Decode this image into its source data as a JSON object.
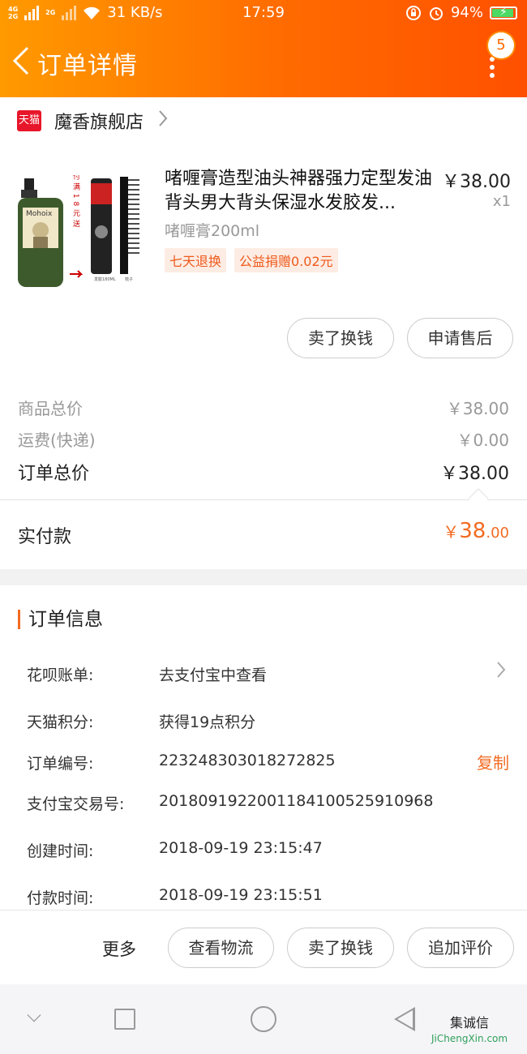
{
  "status_bar": {
    "network_top": "4G",
    "network_bottom": "2G",
    "network2": "2G",
    "speed": "31 KB/s",
    "time": "17:59",
    "battery": "94%"
  },
  "header": {
    "title": "订单详情",
    "badge_count": "5"
  },
  "shop": {
    "icon_text": "天猫",
    "name": "魔香旗舰店"
  },
  "product": {
    "title": "啫喱膏造型油头神器强力定型发油背头男大背头保湿水发胶发...",
    "price": "￥38.00",
    "qty": "x1",
    "sku": "啫喱膏200ml",
    "tags": [
      "七天退换",
      "公益捐赠0.02元"
    ],
    "image_lettering": [
      "Mohoix",
      "实付满18元送",
      "发胶180ML",
      "梳子"
    ]
  },
  "actions": {
    "sell": "卖了换钱",
    "after_sale": "申请售后"
  },
  "summary": {
    "goods_label": "商品总价",
    "goods_value": "￥38.00",
    "shipping_label": "运费(快递)",
    "shipping_value": "￥0.00",
    "total_label": "订单总价",
    "total_value": "￥38.00",
    "paid_label": "实付款",
    "paid_currency": "￥",
    "paid_int": "38",
    "paid_dec": ".00"
  },
  "order_info": {
    "heading": "订单信息",
    "rows": [
      {
        "label": "花呗账单:",
        "value": "去支付宝中查看"
      },
      {
        "label": "天猫积分:",
        "value": "获得19点积分"
      },
      {
        "label": "订单编号:",
        "value": "223248303018272825"
      },
      {
        "label": "支付宝交易号:",
        "value": "2018091922001184100525910968"
      },
      {
        "label": "创建时间:",
        "value": "2018-09-19 23:15:47"
      },
      {
        "label": "付款时间:",
        "value": "2018-09-19 23:15:51"
      }
    ],
    "copy_label": "复制"
  },
  "bottom_bar": {
    "more": "更多",
    "logistics": "查看物流",
    "sell": "卖了换钱",
    "review": "追加评价"
  },
  "watermark": {
    "text": "集诚信",
    "url": "JiChengXin.com"
  },
  "colors": {
    "header_start": "#ff9a00",
    "header_end": "#ff5000",
    "accent": "#f26b22",
    "tmall_red": "#e8162a"
  }
}
